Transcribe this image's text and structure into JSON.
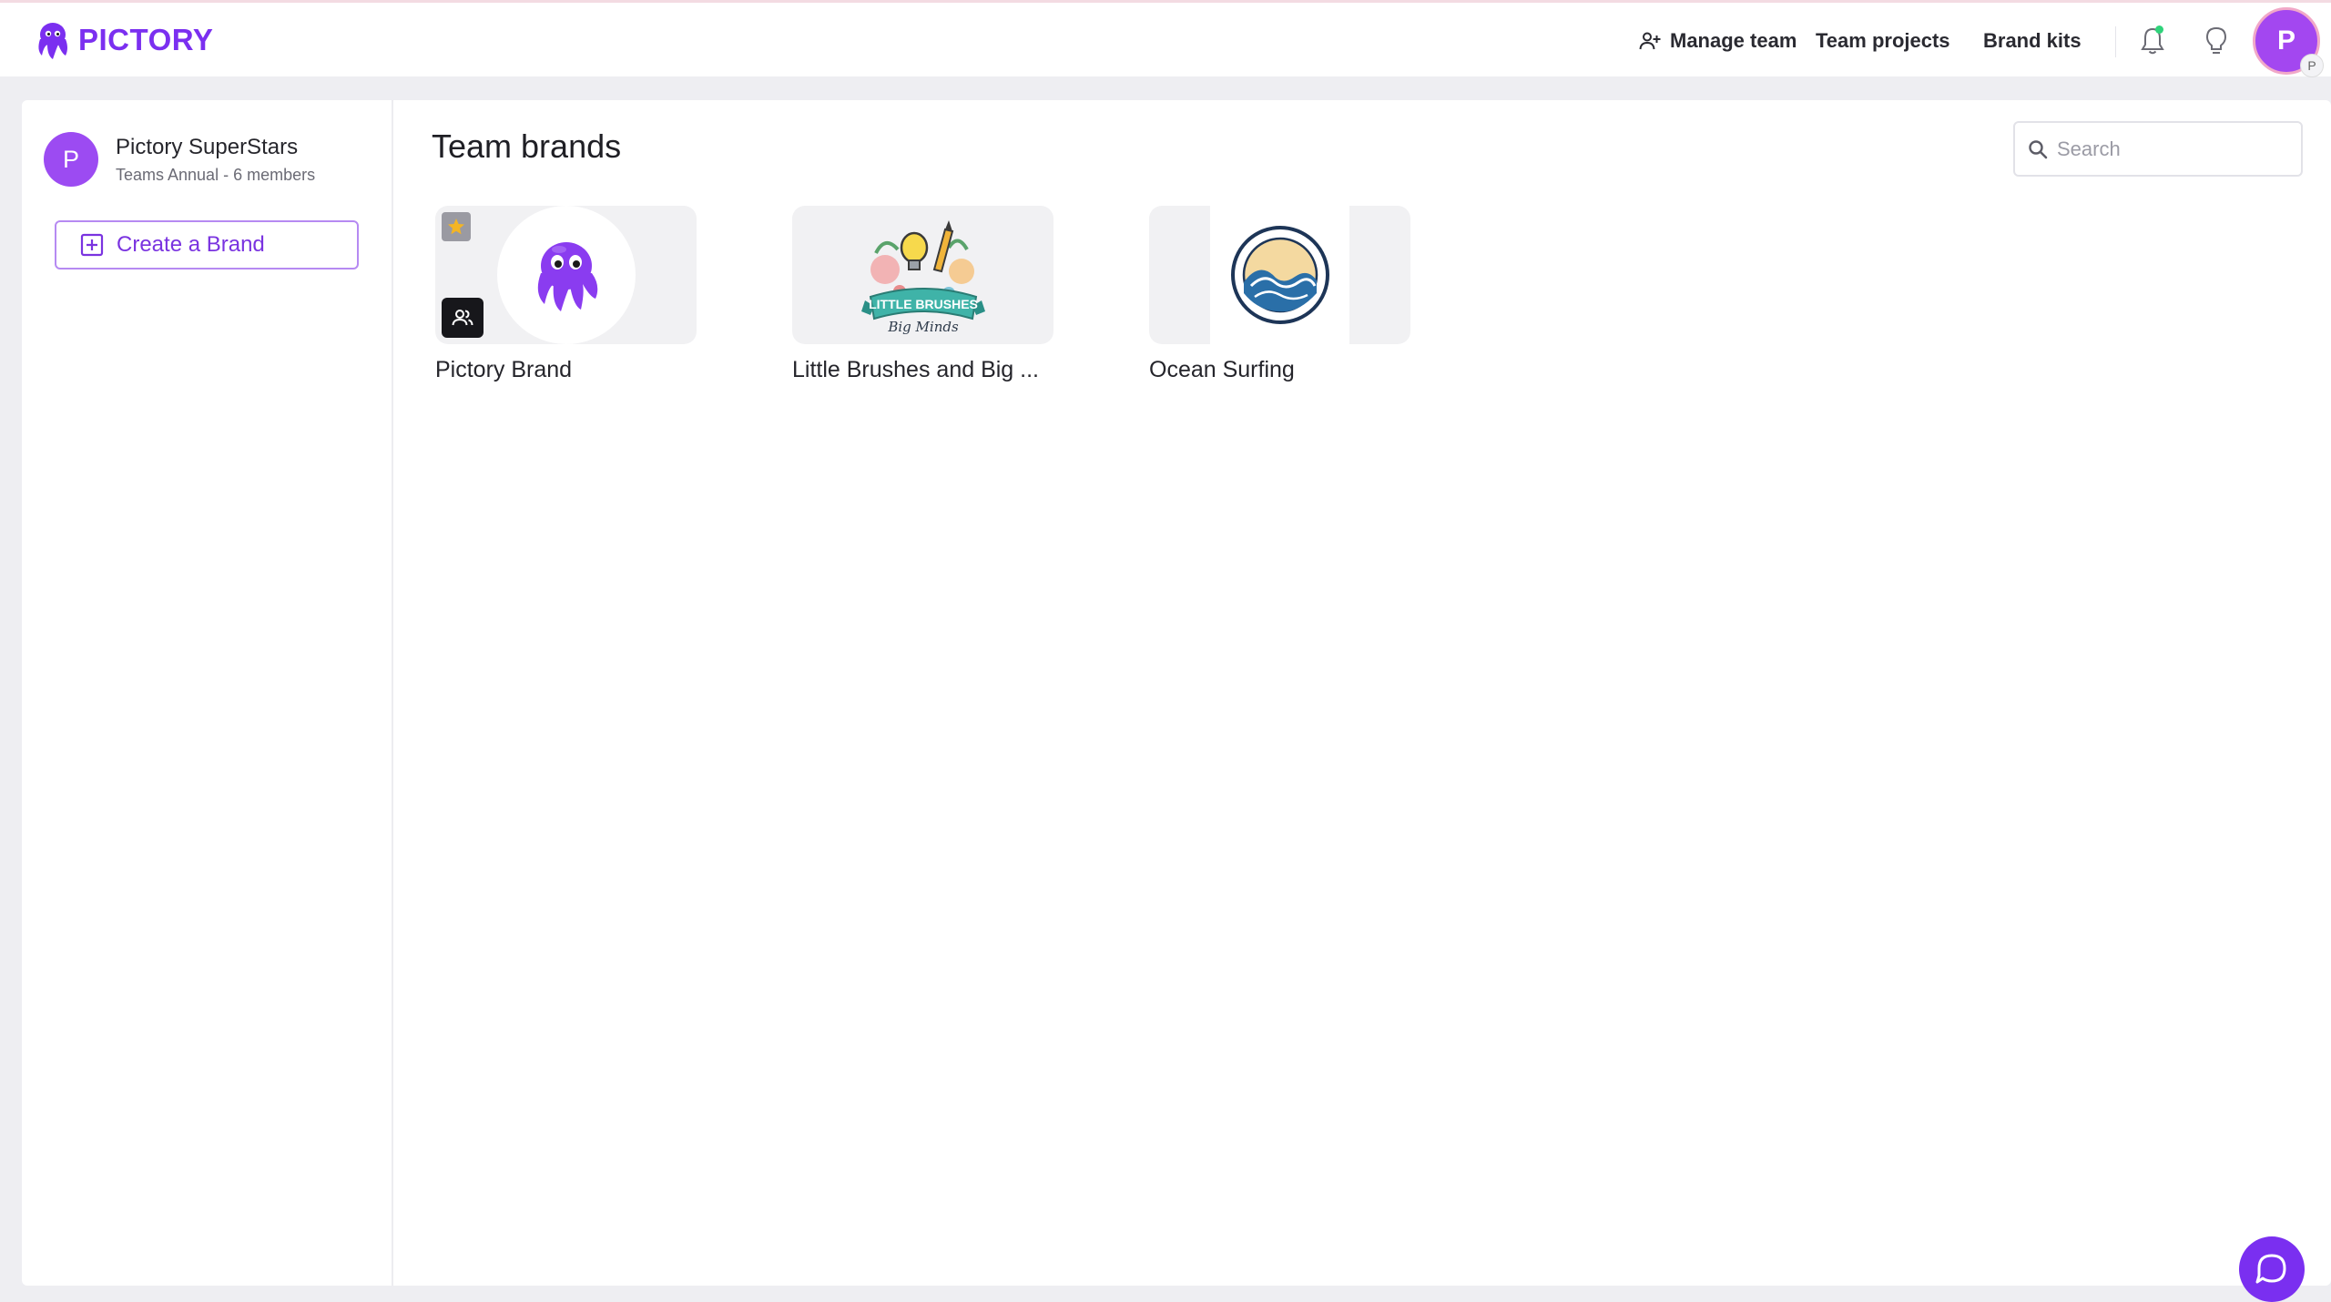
{
  "app": {
    "name": "PICTORY",
    "brand_color": "#7b2ff0"
  },
  "header": {
    "manage_team": "Manage team",
    "team_projects": "Team projects",
    "brand_kits": "Brand kits",
    "user_initial": "P",
    "user_sub_initial": "P",
    "icons": [
      "person-add-icon",
      "bell-icon",
      "lightbulb-icon"
    ]
  },
  "sidebar": {
    "team_initial": "P",
    "team_name": "Pictory SuperStars",
    "team_plan": "Teams Annual - 6 members",
    "create_label": "Create a Brand"
  },
  "main": {
    "title": "Team brands",
    "search_placeholder": "Search",
    "brands": [
      {
        "name": "Pictory Brand",
        "logo": "octopus-logo",
        "badges": [
          "star-icon",
          "team-icon"
        ]
      },
      {
        "name": "Little Brushes and Big ...",
        "logo": "little-brushes-logo"
      },
      {
        "name": "Ocean Surfing",
        "logo": "ocean-surfing-logo"
      }
    ]
  },
  "chat": {
    "icon": "chat-icon"
  }
}
